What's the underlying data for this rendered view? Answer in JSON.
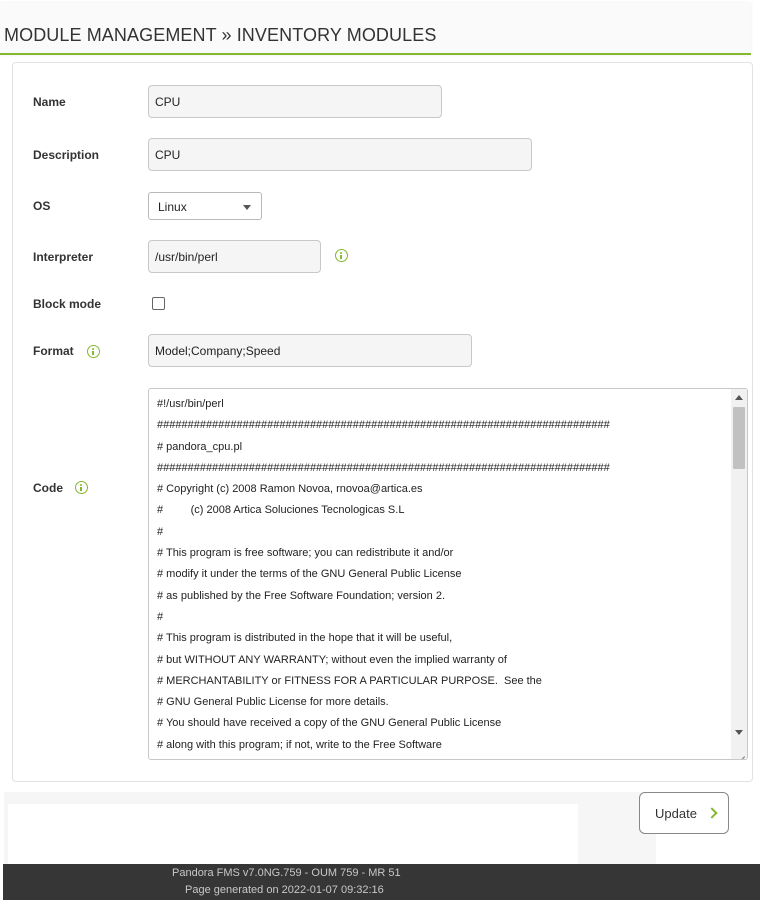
{
  "header": {
    "title": "MODULE MANAGEMENT » INVENTORY MODULES"
  },
  "form": {
    "name": {
      "label": "Name",
      "value": "CPU"
    },
    "description": {
      "label": "Description",
      "value": "CPU"
    },
    "os": {
      "label": "OS",
      "selected": "Linux"
    },
    "interpreter": {
      "label": "Interpreter",
      "value": "/usr/bin/perl",
      "icon": "info-icon"
    },
    "block_mode": {
      "label": "Block mode",
      "checked": false
    },
    "format": {
      "label": "Format",
      "value": "Model;Company;Speed",
      "icon": "info-icon"
    },
    "code": {
      "label": "Code",
      "icon": "info-icon",
      "lines": [
        "#!/usr/bin/perl",
        "##########################################################################",
        "# pandora_cpu.pl",
        "##########################################################################",
        "# Copyright (c) 2008 Ramon Novoa, rnovoa@artica.es",
        "#         (c) 2008 Artica Soluciones Tecnologicas S.L",
        "#",
        "# This program is free software; you can redistribute it and/or",
        "# modify it under the terms of the GNU General Public License",
        "# as published by the Free Software Foundation; version 2.",
        "#",
        "# This program is distributed in the hope that it will be useful,",
        "# but WITHOUT ANY WARRANTY; without even the implied warranty of",
        "# MERCHANTABILITY or FITNESS FOR A PARTICULAR PURPOSE.  See the",
        "# GNU General Public License for more details.",
        "# You should have received a copy of the GNU General Public License",
        "# along with this program; if not, write to the Free Software"
      ]
    }
  },
  "actions": {
    "update_label": "Update"
  },
  "footer": {
    "version": "Pandora FMS v7.0NG.759 - OUM 759 - MR 51",
    "generated": "Page generated on 2022-01-07 09:32:16"
  },
  "colors": {
    "accent": "#82b92e",
    "footer_bg": "#363636"
  }
}
